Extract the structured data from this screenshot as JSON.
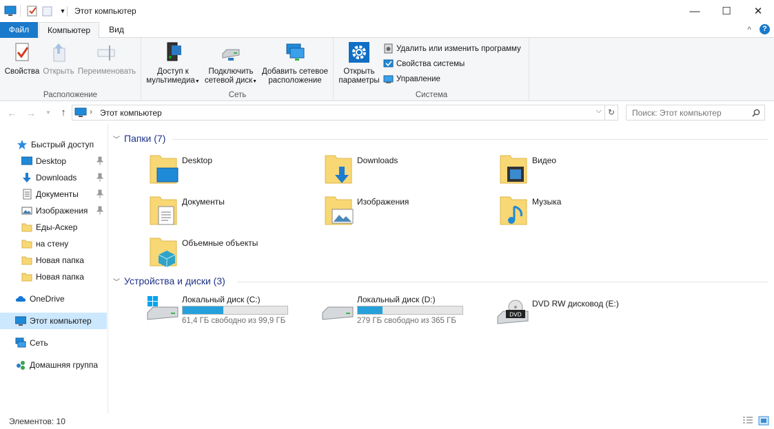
{
  "window": {
    "title": "Этот компьютер",
    "minimize": "—",
    "maximize": "☐",
    "close": "✕"
  },
  "tabs": {
    "file": "Файл",
    "computer": "Компьютер",
    "view": "Вид",
    "collapse": "^",
    "help": "?"
  },
  "ribbon": {
    "location": {
      "label": "Расположение",
      "properties": "Свойства",
      "open": "Открыть",
      "rename": "Переименовать"
    },
    "network": {
      "label": "Сеть",
      "media_l1": "Доступ к",
      "media_l2": "мультимедиа",
      "map_l1": "Подключить",
      "map_l2": "сетевой диск",
      "add_l1": "Добавить сетевое",
      "add_l2": "расположение"
    },
    "system": {
      "label": "Система",
      "settings_l1": "Открыть",
      "settings_l2": "параметры",
      "uninstall": "Удалить или изменить программу",
      "sysprops": "Свойства системы",
      "manage": "Управление"
    }
  },
  "address": {
    "sep": "›",
    "path": "Этот компьютер",
    "dropdown": "⌵",
    "refresh": "↻",
    "search_placeholder": "Поиск: Этот компьютер"
  },
  "navpane": {
    "quick_access": "Быстрый доступ",
    "desktop": "Desktop",
    "downloads": "Downloads",
    "documents": "Документы",
    "pictures": "Изображения",
    "folder1": "Еды-Аскер",
    "folder2": "на стену",
    "folder3": "Новая папка",
    "folder4": "Новая папка",
    "onedrive": "OneDrive",
    "thispc": "Этот компьютер",
    "network": "Сеть",
    "homegroup": "Домашняя группа"
  },
  "folders_section": {
    "title": "Папки (7)",
    "items": [
      "Desktop",
      "Downloads",
      "Видео",
      "Документы",
      "Изображения",
      "Музыка",
      "Объемные объекты"
    ]
  },
  "drives_section": {
    "title": "Устройства и диски (3)",
    "c": {
      "name": "Локальный диск (C:)",
      "free": "61,4 ГБ свободно из 99,9 ГБ",
      "used_fraction": 0.385
    },
    "d": {
      "name": "Локальный диск (D:)",
      "free": "279 ГБ свободно из 365 ГБ",
      "used_fraction": 0.236
    },
    "e": {
      "name": "DVD RW дисковод (E:)",
      "badge": "DVD"
    }
  },
  "status": {
    "items_count": "Элементов: 10"
  },
  "colors": {
    "accent": "#1979ca",
    "selection": "#cce8ff",
    "progress": "#26a0da",
    "folder_yellow": "#f8d775"
  }
}
